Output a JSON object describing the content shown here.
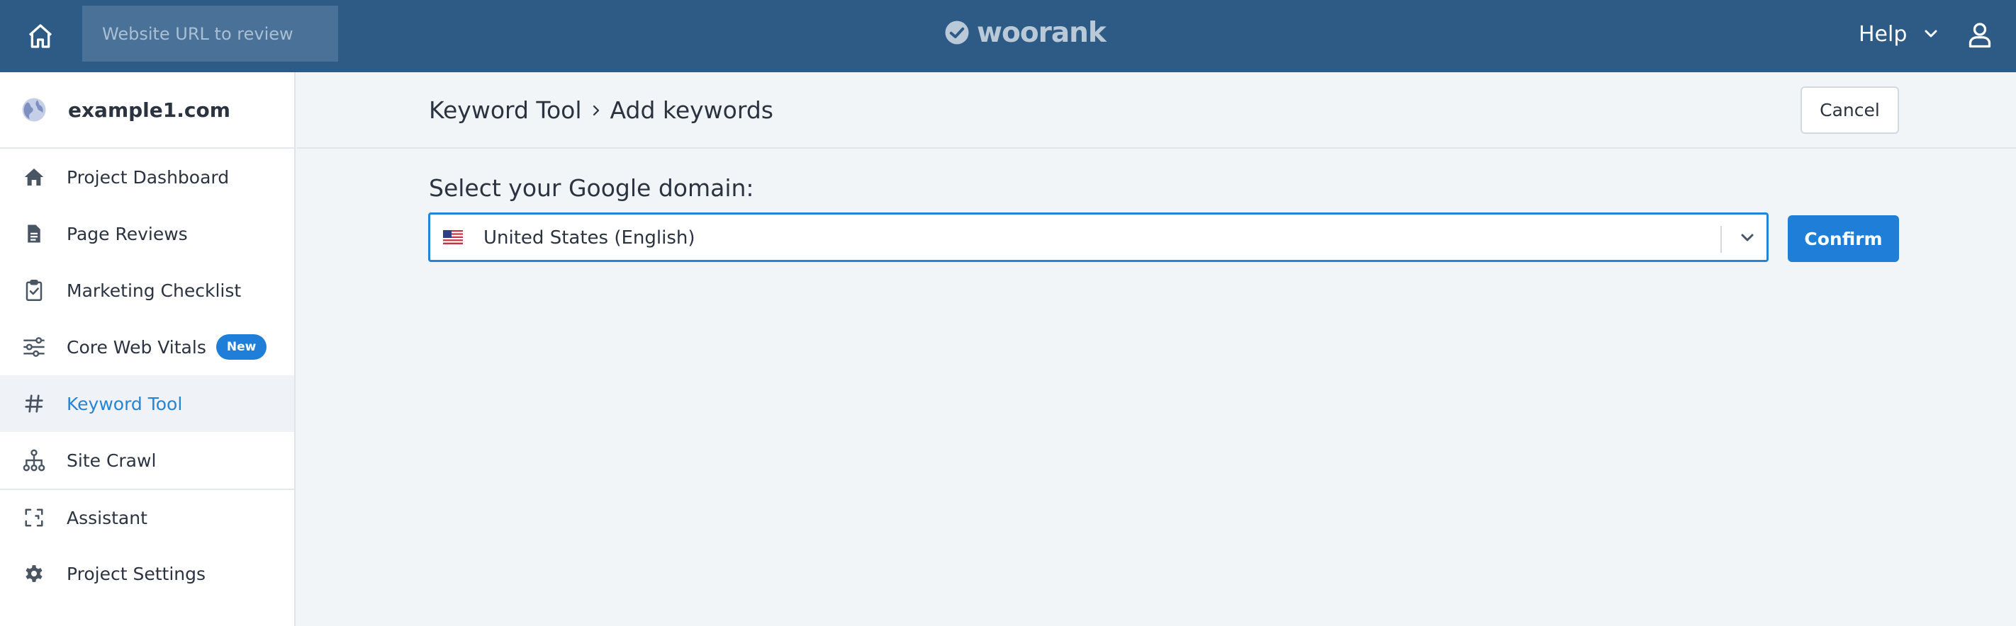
{
  "topbar": {
    "search_placeholder": "Website URL to review",
    "brand": "woorank",
    "help_label": "Help",
    "icons": {
      "home": "home-icon",
      "user": "user-icon",
      "help_menu": "chevron-down-icon"
    },
    "colors": {
      "background": "#2d5b86",
      "input_bg": "#4a7298"
    }
  },
  "sidebar": {
    "project_name": "example1.com",
    "items": [
      {
        "label": "Project Dashboard",
        "icon": "house-icon"
      },
      {
        "label": "Page Reviews",
        "icon": "document-icon"
      },
      {
        "label": "Marketing Checklist",
        "icon": "clipboard-check-icon"
      },
      {
        "label": "Core Web Vitals",
        "icon": "sliders-icon",
        "badge": "New"
      },
      {
        "label": "Keyword Tool",
        "icon": "hashtag-icon",
        "active": true
      },
      {
        "label": "Site Crawl",
        "icon": "sitemap-icon"
      },
      {
        "label": "Assistant",
        "icon": "scan-icon"
      },
      {
        "label": "Project Settings",
        "icon": "gear-icon"
      }
    ]
  },
  "main": {
    "breadcrumb": {
      "parent": "Keyword Tool",
      "current": "Add keywords"
    },
    "cancel_label": "Cancel",
    "domain_label": "Select your Google domain:",
    "domain_select": {
      "value": "United States (English)",
      "flag": "us-flag-icon"
    },
    "confirm_label": "Confirm",
    "colors": {
      "accent": "#1f7fd8",
      "active_nav_text": "#2584d6"
    }
  }
}
